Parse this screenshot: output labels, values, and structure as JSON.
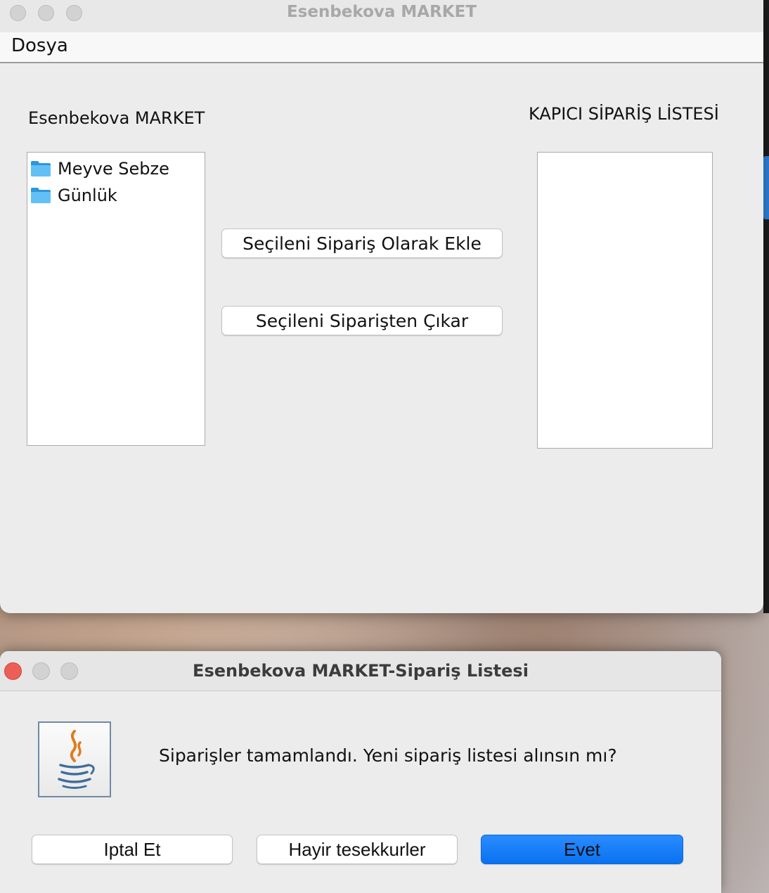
{
  "main_window": {
    "title": "Esenbekova MARKET",
    "menu": {
      "file_label": "Dosya"
    },
    "catalog_label": "Esenbekova MARKET",
    "order_list_label": "KAPICI SİPARİŞ LİSTESİ",
    "tree_items": [
      {
        "label": "Meyve Sebze",
        "icon": "folder-icon"
      },
      {
        "label": "Günlük",
        "icon": "folder-icon"
      }
    ],
    "add_button_label": "Seçileni Sipariş Olarak Ekle",
    "remove_button_label": "Seçileni Siparişten Çıkar"
  },
  "dialog": {
    "title": "Esenbekova MARKET-Sipariş Listesi",
    "icon": "java-icon",
    "message": "Siparişler tamamlandı. Yeni sipariş listesi alınsın mı?",
    "buttons": {
      "cancel_label": "Iptal Et",
      "no_label": "Hayir tesekkurler",
      "yes_label": "Evet"
    }
  },
  "colors": {
    "accent": "#0a72f0",
    "close_red": "#ec5f57",
    "inactive_gray": "#d2d2d2",
    "folder_blue": "#5ab8f3"
  }
}
